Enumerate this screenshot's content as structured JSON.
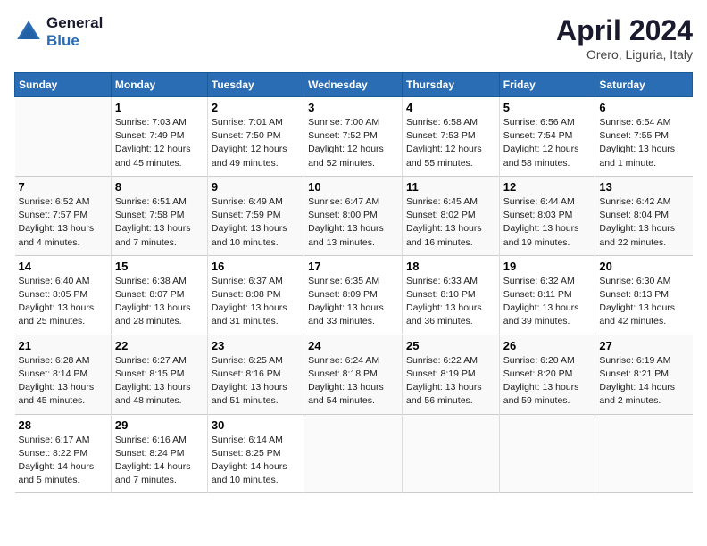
{
  "header": {
    "logo_line1": "General",
    "logo_line2": "Blue",
    "month": "April 2024",
    "location": "Orero, Liguria, Italy"
  },
  "weekdays": [
    "Sunday",
    "Monday",
    "Tuesday",
    "Wednesday",
    "Thursday",
    "Friday",
    "Saturday"
  ],
  "weeks": [
    [
      {
        "day": "",
        "info": ""
      },
      {
        "day": "1",
        "info": "Sunrise: 7:03 AM\nSunset: 7:49 PM\nDaylight: 12 hours\nand 45 minutes."
      },
      {
        "day": "2",
        "info": "Sunrise: 7:01 AM\nSunset: 7:50 PM\nDaylight: 12 hours\nand 49 minutes."
      },
      {
        "day": "3",
        "info": "Sunrise: 7:00 AM\nSunset: 7:52 PM\nDaylight: 12 hours\nand 52 minutes."
      },
      {
        "day": "4",
        "info": "Sunrise: 6:58 AM\nSunset: 7:53 PM\nDaylight: 12 hours\nand 55 minutes."
      },
      {
        "day": "5",
        "info": "Sunrise: 6:56 AM\nSunset: 7:54 PM\nDaylight: 12 hours\nand 58 minutes."
      },
      {
        "day": "6",
        "info": "Sunrise: 6:54 AM\nSunset: 7:55 PM\nDaylight: 13 hours\nand 1 minute."
      }
    ],
    [
      {
        "day": "7",
        "info": "Sunrise: 6:52 AM\nSunset: 7:57 PM\nDaylight: 13 hours\nand 4 minutes."
      },
      {
        "day": "8",
        "info": "Sunrise: 6:51 AM\nSunset: 7:58 PM\nDaylight: 13 hours\nand 7 minutes."
      },
      {
        "day": "9",
        "info": "Sunrise: 6:49 AM\nSunset: 7:59 PM\nDaylight: 13 hours\nand 10 minutes."
      },
      {
        "day": "10",
        "info": "Sunrise: 6:47 AM\nSunset: 8:00 PM\nDaylight: 13 hours\nand 13 minutes."
      },
      {
        "day": "11",
        "info": "Sunrise: 6:45 AM\nSunset: 8:02 PM\nDaylight: 13 hours\nand 16 minutes."
      },
      {
        "day": "12",
        "info": "Sunrise: 6:44 AM\nSunset: 8:03 PM\nDaylight: 13 hours\nand 19 minutes."
      },
      {
        "day": "13",
        "info": "Sunrise: 6:42 AM\nSunset: 8:04 PM\nDaylight: 13 hours\nand 22 minutes."
      }
    ],
    [
      {
        "day": "14",
        "info": "Sunrise: 6:40 AM\nSunset: 8:05 PM\nDaylight: 13 hours\nand 25 minutes."
      },
      {
        "day": "15",
        "info": "Sunrise: 6:38 AM\nSunset: 8:07 PM\nDaylight: 13 hours\nand 28 minutes."
      },
      {
        "day": "16",
        "info": "Sunrise: 6:37 AM\nSunset: 8:08 PM\nDaylight: 13 hours\nand 31 minutes."
      },
      {
        "day": "17",
        "info": "Sunrise: 6:35 AM\nSunset: 8:09 PM\nDaylight: 13 hours\nand 33 minutes."
      },
      {
        "day": "18",
        "info": "Sunrise: 6:33 AM\nSunset: 8:10 PM\nDaylight: 13 hours\nand 36 minutes."
      },
      {
        "day": "19",
        "info": "Sunrise: 6:32 AM\nSunset: 8:11 PM\nDaylight: 13 hours\nand 39 minutes."
      },
      {
        "day": "20",
        "info": "Sunrise: 6:30 AM\nSunset: 8:13 PM\nDaylight: 13 hours\nand 42 minutes."
      }
    ],
    [
      {
        "day": "21",
        "info": "Sunrise: 6:28 AM\nSunset: 8:14 PM\nDaylight: 13 hours\nand 45 minutes."
      },
      {
        "day": "22",
        "info": "Sunrise: 6:27 AM\nSunset: 8:15 PM\nDaylight: 13 hours\nand 48 minutes."
      },
      {
        "day": "23",
        "info": "Sunrise: 6:25 AM\nSunset: 8:16 PM\nDaylight: 13 hours\nand 51 minutes."
      },
      {
        "day": "24",
        "info": "Sunrise: 6:24 AM\nSunset: 8:18 PM\nDaylight: 13 hours\nand 54 minutes."
      },
      {
        "day": "25",
        "info": "Sunrise: 6:22 AM\nSunset: 8:19 PM\nDaylight: 13 hours\nand 56 minutes."
      },
      {
        "day": "26",
        "info": "Sunrise: 6:20 AM\nSunset: 8:20 PM\nDaylight: 13 hours\nand 59 minutes."
      },
      {
        "day": "27",
        "info": "Sunrise: 6:19 AM\nSunset: 8:21 PM\nDaylight: 14 hours\nand 2 minutes."
      }
    ],
    [
      {
        "day": "28",
        "info": "Sunrise: 6:17 AM\nSunset: 8:22 PM\nDaylight: 14 hours\nand 5 minutes."
      },
      {
        "day": "29",
        "info": "Sunrise: 6:16 AM\nSunset: 8:24 PM\nDaylight: 14 hours\nand 7 minutes."
      },
      {
        "day": "30",
        "info": "Sunrise: 6:14 AM\nSunset: 8:25 PM\nDaylight: 14 hours\nand 10 minutes."
      },
      {
        "day": "",
        "info": ""
      },
      {
        "day": "",
        "info": ""
      },
      {
        "day": "",
        "info": ""
      },
      {
        "day": "",
        "info": ""
      }
    ]
  ]
}
